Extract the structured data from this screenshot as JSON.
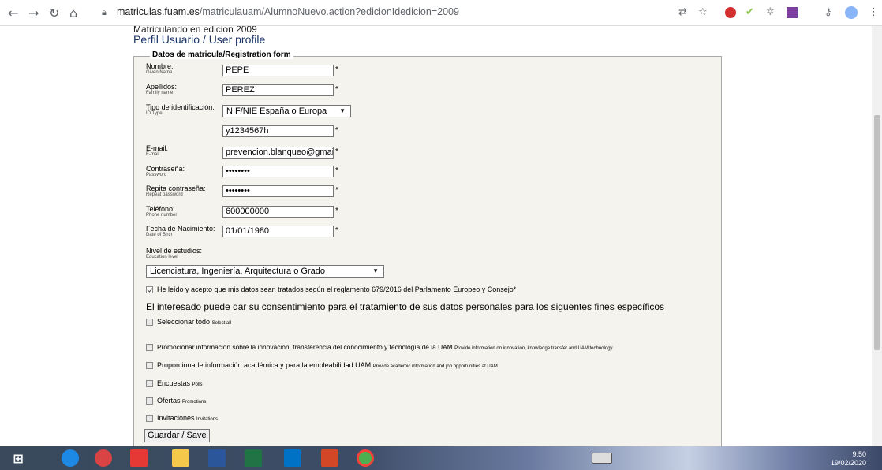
{
  "browser": {
    "url_host": "matriculas.fuam.es",
    "url_path": "/matriculauam/AlumnoNuevo.action?edicionIdedicion=2009"
  },
  "header": {
    "subtitle": "Matriculando en edicion 2009",
    "title": "Perfil Usuario / User profile"
  },
  "form": {
    "legend": "Datos de matricula/Registration form",
    "required_mark": "*",
    "fields": {
      "nombre": {
        "label": "Nombre:",
        "sub": "Given Name",
        "value": "PEPE"
      },
      "apellidos": {
        "label": "Apellidos:",
        "sub": "Family name",
        "value": "PEREZ"
      },
      "tipo_id": {
        "label": "Tipo de identificación:",
        "sub": "ID Type",
        "value": "NIF/NIE España o Europa"
      },
      "id_number": {
        "value": "y1234567h"
      },
      "email": {
        "label": "E-mail:",
        "sub": "E-mail",
        "value": "prevencion.blanqueo@gmail"
      },
      "password": {
        "label": "Contraseña:",
        "sub": "Password",
        "value": "••••••••"
      },
      "password2": {
        "label": "Repita contraseña:",
        "sub": "Repeat password",
        "value": "••••••••"
      },
      "telefono": {
        "label": "Teléfono:",
        "sub": "Phone number",
        "value": "600000000"
      },
      "nacimiento": {
        "label": "Fecha de Nacimiento:",
        "sub": "Date of Birth",
        "value": "01/01/1980"
      },
      "nivel": {
        "label": "Nivel de estudios:",
        "sub": "Education level",
        "value": "Licenciatura, Ingeniería, Arquitectura o Grado"
      }
    },
    "privacy_check": "He leído y acepto que mis datos sean tratados según el reglamento 679/2016 del Parlamento Europeo y Consejo*",
    "consent_text": "El interesado puede dar su consentimiento para el tratamiento de sus datos personales para los siguentes fines específicos",
    "options": [
      {
        "es": "Seleccionar todo",
        "en": "Select all"
      },
      {
        "es": "Promocionar información sobre la innovación, transferencia del conocimiento y tecnología de la UAM",
        "en": "Provide information on innovation, knowledge transfer and UAM technology"
      },
      {
        "es": "Proporcionarle información académica y para la empleabilidad UAM",
        "en": "Provide academic information and job opportunities at UAM"
      },
      {
        "es": "Encuestas",
        "en": "Polls"
      },
      {
        "es": "Ofertas",
        "en": "Promotions"
      },
      {
        "es": "Invitaciones",
        "en": "Invitations"
      }
    ],
    "save_label": "Guardar / Save"
  },
  "taskbar": {
    "time": "9:50",
    "date": "19/02/2020"
  }
}
